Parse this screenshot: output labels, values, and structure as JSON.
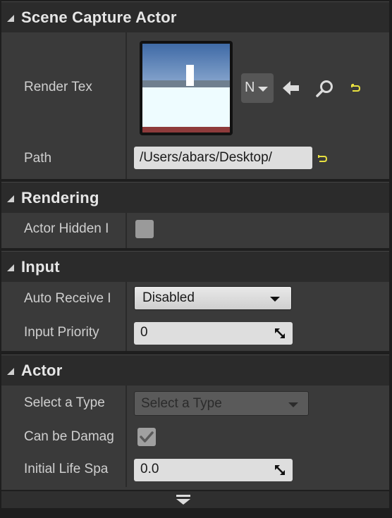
{
  "sections": {
    "scene_capture": {
      "title": "Scene Capture Actor"
    },
    "rendering": {
      "title": "Rendering"
    },
    "input": {
      "title": "Input"
    },
    "actor": {
      "title": "Actor"
    }
  },
  "scene_capture": {
    "render_tex_label": "Render Tex",
    "asset_picker_label": "N",
    "path_label": "Path",
    "path_value": "/Users/abars/Desktop/"
  },
  "rendering": {
    "actor_hidden_label": "Actor Hidden I"
  },
  "input": {
    "auto_receive_label": "Auto Receive I",
    "auto_receive_value": "Disabled",
    "input_priority_label": "Input Priority",
    "input_priority_value": "0"
  },
  "actor": {
    "select_type_label": "Select a Type",
    "select_type_value": "Select a Type",
    "can_be_damaged_label": "Can be Damag",
    "can_be_damaged_checked": true,
    "initial_life_label": "Initial Life Spa",
    "initial_life_value": "0.0"
  },
  "icons": {
    "use_selected": "left-arrow-icon",
    "browse": "magnifier-icon",
    "reset": "reset-to-default-icon",
    "expand_more": "expand-down-icon"
  },
  "colors": {
    "reset_icon": "#e8e040",
    "header_bg": "#2b2b2b",
    "row_bg": "#3a3a3a"
  }
}
